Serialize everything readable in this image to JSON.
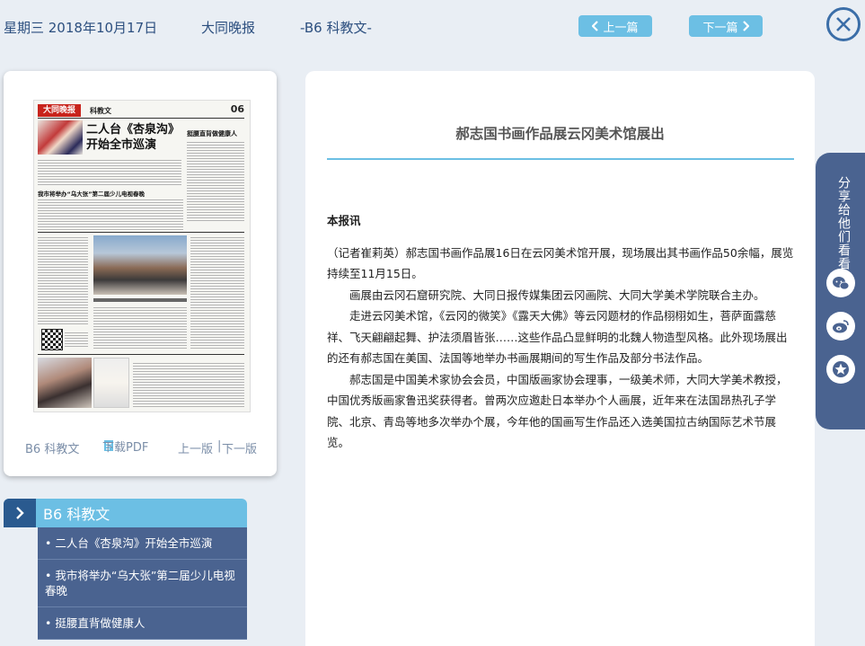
{
  "header": {
    "date": "星期三 2018年10月17日",
    "paper_name": "大同晚报",
    "section": "-B6 科教文-",
    "prev_label": "上一篇",
    "next_label": "下一篇"
  },
  "thumbnail": {
    "masthead": "大同晚报",
    "section": "科教文",
    "page_number": "06",
    "headline": "二人台《杏泉沟》开始全市巡演",
    "sub_headline": "我市将举办“乌大张”第二届少儿电视春晚",
    "side_headline": "挺腰直背做健康人",
    "footer": {
      "page_label": "B6 科教文",
      "pdf_label": "下载PDF",
      "prev_page": "上一版",
      "next_page": "下一版",
      "separator": "|"
    }
  },
  "toc": {
    "title": "B6 科教文",
    "items": [
      "二人台《杏泉沟》开始全市巡演",
      "我市将举办“乌大张”第二届少儿电视春晚",
      "挺腰直背做健康人"
    ]
  },
  "article": {
    "title": "郝志国书画作品展云冈美术馆展出",
    "lead": "本报讯",
    "paragraphs": [
      "（记者崔莉英）郝志国书画作品展16日在云冈美术馆开展，现场展出其书画作品50余幅，展览持续至11月15日。",
      "画展由云冈石窟研究院、大同日报传媒集团云冈画院、大同大学美术学院联合主办。",
      "走进云冈美术馆，《云冈的微笑》《露天大佛》等云冈题材的作品栩栩如生，菩萨面露慈祥、飞天翩翩起舞、护法须眉皆张……这些作品凸显鲜明的北魏人物造型风格。此外现场展出的还有郝志国在美国、法国等地举办书画展期间的写生作品及部分书法作品。",
      "郝志国是中国美术家协会会员，中国版画家协会理事，一级美术师，大同大学美术教授，中国优秀版画家鲁迅奖获得者。曾两次应邀赴日本举办个人画展，近年来在法国昂热孔子学院、北京、青岛等地多次举办个展，今年他的国画写生作品还入选美国拉古纳国际艺术节展览。"
    ]
  },
  "share": {
    "label": "分享给他们看看",
    "icons": [
      "wechat-icon",
      "weibo-icon",
      "qzone-icon"
    ]
  },
  "colors": {
    "accent": "#6cbfe4",
    "navy": "#4a6390",
    "dark_blue": "#2a5a8f",
    "background": "#e9eef4"
  }
}
